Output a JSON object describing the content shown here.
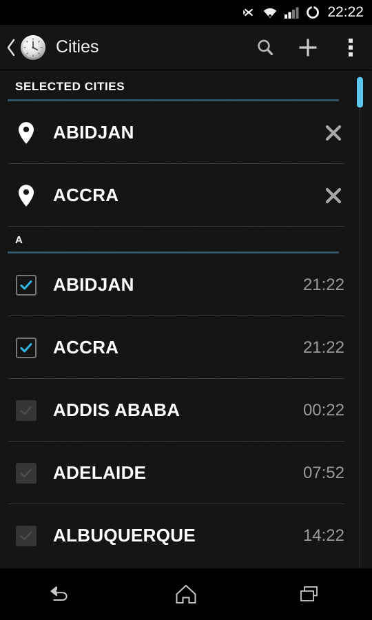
{
  "status_bar": {
    "time": "22:22",
    "icons": [
      "bluetooth-off-icon",
      "wifi-icon",
      "cellular-signal-icon",
      "ring-mode-icon"
    ]
  },
  "action_bar": {
    "back_label": "",
    "app_icon": "clock-icon",
    "title": "Cities",
    "actions": [
      {
        "name": "search-icon",
        "label": "Search"
      },
      {
        "name": "add-icon",
        "label": "Add"
      },
      {
        "name": "overflow-menu-icon",
        "label": "More options"
      }
    ]
  },
  "selected_section": {
    "header": "SELECTED CITIES",
    "items": [
      {
        "name": "ABIDJAN",
        "remove_label": "Remove"
      },
      {
        "name": "ACCRA",
        "remove_label": "Remove"
      }
    ]
  },
  "alpha_section": {
    "header": "A",
    "items": [
      {
        "name": "ABIDJAN",
        "time": "21:22",
        "checked": true
      },
      {
        "name": "ACCRA",
        "time": "21:22",
        "checked": true
      },
      {
        "name": "ADDIS ABABA",
        "time": "00:22",
        "checked": false
      },
      {
        "name": "ADELAIDE",
        "time": "07:52",
        "checked": false
      },
      {
        "name": "ALBUQUERQUE",
        "time": "14:22",
        "checked": false
      }
    ]
  },
  "nav_bar": {
    "buttons": [
      {
        "name": "back-nav-icon",
        "label": "Back"
      },
      {
        "name": "home-nav-icon",
        "label": "Home"
      },
      {
        "name": "recents-nav-icon",
        "label": "Recents"
      }
    ]
  },
  "colors": {
    "accent": "#5cc8f2",
    "section_rule": "#33536b",
    "background": "#151515",
    "time_text": "#9a9a9a"
  }
}
